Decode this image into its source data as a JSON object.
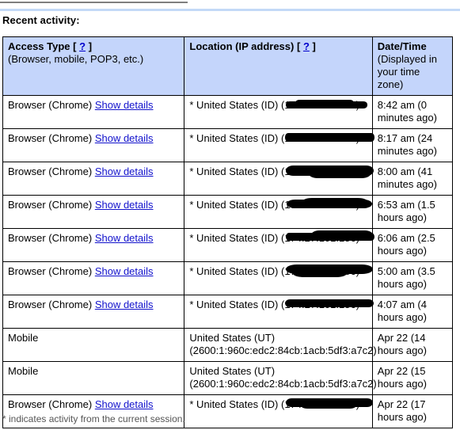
{
  "heading": "Recent activity:",
  "table": {
    "columns": [
      {
        "title": "Access Type",
        "help": "?",
        "bracket_open": "[",
        "bracket_close": "]",
        "subtitle": "(Browser, mobile, POP3, etc.)"
      },
      {
        "title": "Location (IP address)",
        "help": "?",
        "bracket_open": "[",
        "bracket_close": "]",
        "subtitle": ""
      },
      {
        "title": "Date/Time",
        "subtitle_line1": "(Displayed in",
        "subtitle_line2": "your time zone)"
      }
    ],
    "rows": [
      {
        "access_type": "Browser (Chrome)",
        "details_link": "Show details",
        "location_line1": "* United States (ID) (",
        "location_line2": "",
        "ip_redacted": true,
        "datetime": "8:42 am (0 minutes ago)"
      },
      {
        "access_type": "Browser (Chrome)",
        "details_link": "Show details",
        "location_line1": "* United States (ID) (",
        "location_line2": "",
        "ip_redacted": true,
        "datetime": "8:17 am (24 minutes ago)"
      },
      {
        "access_type": "Browser (Chrome)",
        "details_link": "Show details",
        "location_line1": "* United States (ID) (",
        "location_line2": "",
        "ip_redacted": true,
        "datetime": "8:00 am (41 minutes ago)"
      },
      {
        "access_type": "Browser (Chrome)",
        "details_link": "Show details",
        "location_line1": "* United States (ID) (",
        "location_line2": "",
        "ip_redacted": true,
        "datetime": "6:53 am (1.5 hours ago)"
      },
      {
        "access_type": "Browser (Chrome)",
        "details_link": "Show details",
        "location_line1": "* United States (ID) (",
        "location_line2": "",
        "ip_redacted": true,
        "datetime": "6:06 am (2.5 hours ago)"
      },
      {
        "access_type": "Browser (Chrome)",
        "details_link": "Show details",
        "location_line1": "* United States (ID) (",
        "location_line2": "",
        "ip_redacted": true,
        "datetime": "5:00 am (3.5 hours ago)"
      },
      {
        "access_type": "Browser (Chrome)",
        "details_link": "Show details",
        "location_line1": "* United States (ID) (",
        "location_line2": "",
        "ip_redacted": true,
        "datetime": "4:07 am (4 hours ago)"
      },
      {
        "access_type": "Mobile",
        "details_link": "",
        "location_line1": "United States (UT)",
        "location_line2": "(2600:1:960c:edc2:84cb:1acb:5df3:a7c2)",
        "ip_redacted": false,
        "datetime": "Apr 22 (14 hours ago)"
      },
      {
        "access_type": "Mobile",
        "details_link": "",
        "location_line1": "United States (UT)",
        "location_line2": "(2600:1:960c:edc2:84cb:1acb:5df3:a7c2)",
        "ip_redacted": false,
        "datetime": "Apr 22 (15 hours ago)"
      },
      {
        "access_type": "Browser (Chrome)",
        "details_link": "Show details",
        "location_line1": "* United States (ID) (",
        "location_line2": "",
        "ip_redacted": true,
        "datetime": "Apr 22 (17 hours ago)"
      }
    ]
  },
  "footnote": "* indicates activity from the current session.",
  "colors": {
    "header_background": "#c4d5fb",
    "link": "#1111cc",
    "top_rule_gray": "#7f7f7f",
    "top_rule_blue": "#c3d9f7",
    "redaction": "#000000",
    "footnote_text": "#555555"
  }
}
